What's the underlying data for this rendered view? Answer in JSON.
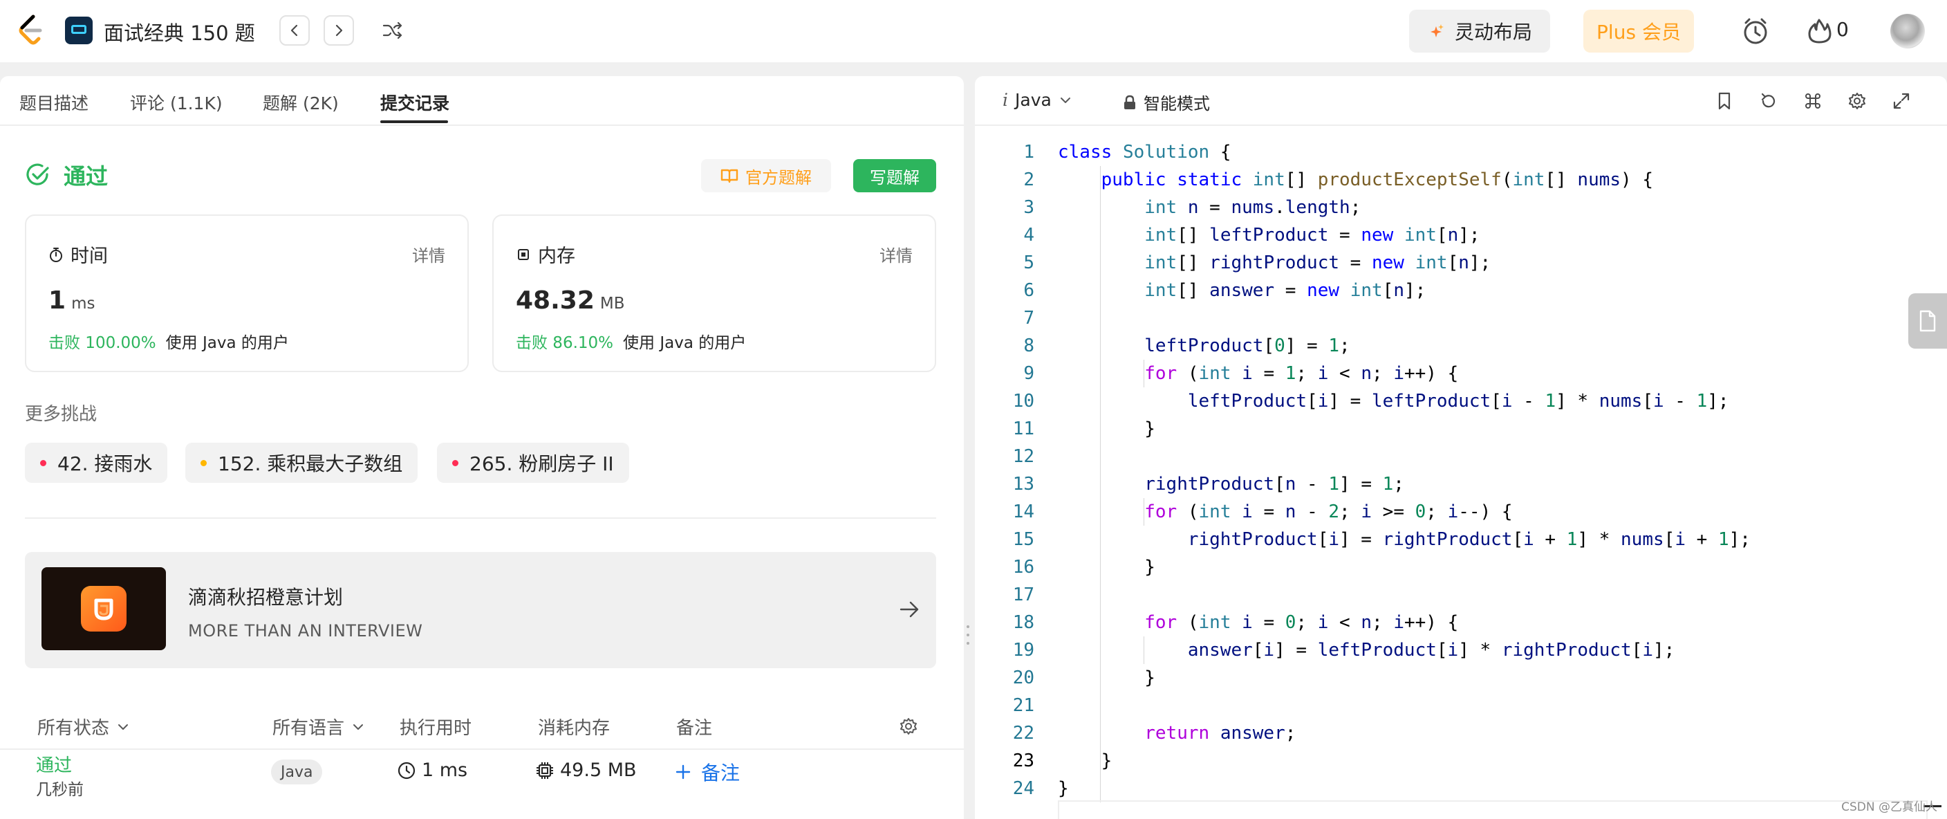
{
  "header": {
    "problem_list_title": "面试经典 150 题",
    "layout_button": "灵动布局",
    "plus_button": "Plus 会员",
    "streak_count": "0"
  },
  "tabs": [
    "题目描述",
    "评论 (1.1K)",
    "题解 (2K)",
    "提交记录"
  ],
  "submission": {
    "status": "通过",
    "official_solution_button": "官方题解",
    "write_solution_button": "写题解",
    "time_card": {
      "label": "时间",
      "detail": "详情",
      "value": "1",
      "unit": "ms",
      "beat_pct": "击败 100.00%",
      "beat_text": "使用 Java 的用户"
    },
    "memory_card": {
      "label": "内存",
      "detail": "详情",
      "value": "48.32",
      "unit": "MB",
      "beat_pct": "击败 86.10%",
      "beat_text": "使用 Java 的用户"
    }
  },
  "more_challenges": {
    "title": "更多挑战",
    "items": [
      {
        "label": "42. 接雨水",
        "color": "#ff2d55"
      },
      {
        "label": "152. 乘积最大子数组",
        "color": "#ffb700"
      },
      {
        "label": "265. 粉刷房子 II",
        "color": "#ff2d55"
      }
    ]
  },
  "ad": {
    "title": "滴滴秋招橙意计划",
    "subtitle": "MORE THAN AN INTERVIEW"
  },
  "table": {
    "headers": {
      "status": "所有状态",
      "language": "所有语言",
      "runtime": "执行用时",
      "memory": "消耗内存",
      "note": "备注"
    },
    "rows": [
      {
        "status": "通过",
        "time_ago": "几秒前",
        "language": "Java",
        "runtime": "1 ms",
        "memory": "49.5 MB",
        "note": "备注"
      }
    ]
  },
  "editor": {
    "language": "Java",
    "mode": "智能模式",
    "lines": [
      "class Solution {",
      "    public static int[] productExceptSelf(int[] nums) {",
      "        int n = nums.length;",
      "        int[] leftProduct = new int[n];",
      "        int[] rightProduct = new int[n];",
      "        int[] answer = new int[n];",
      "",
      "        leftProduct[0] = 1;",
      "        for (int i = 1; i < n; i++) {",
      "            leftProduct[i] = leftProduct[i - 1] * nums[i - 1];",
      "        }",
      "",
      "        rightProduct[n - 1] = 1;",
      "        for (int i = n - 2; i >= 0; i--) {",
      "            rightProduct[i] = rightProduct[i + 1] * nums[i + 1];",
      "        }",
      "",
      "        for (int i = 0; i < n; i++) {",
      "            answer[i] = leftProduct[i] * rightProduct[i];",
      "        }",
      "",
      "        return answer;",
      "    }",
      "}"
    ],
    "current_line": 23
  },
  "watermark": "CSDN @乙真仙人",
  "colors": {
    "accent_green": "#2db55d",
    "accent_orange": "#ff9f1a",
    "link_blue": "#1a73e8",
    "keyword": "#0000ff",
    "keyword_control": "#af00db",
    "type": "#267f99",
    "number": "#098658",
    "function": "#795e26",
    "variable": "#001080"
  }
}
